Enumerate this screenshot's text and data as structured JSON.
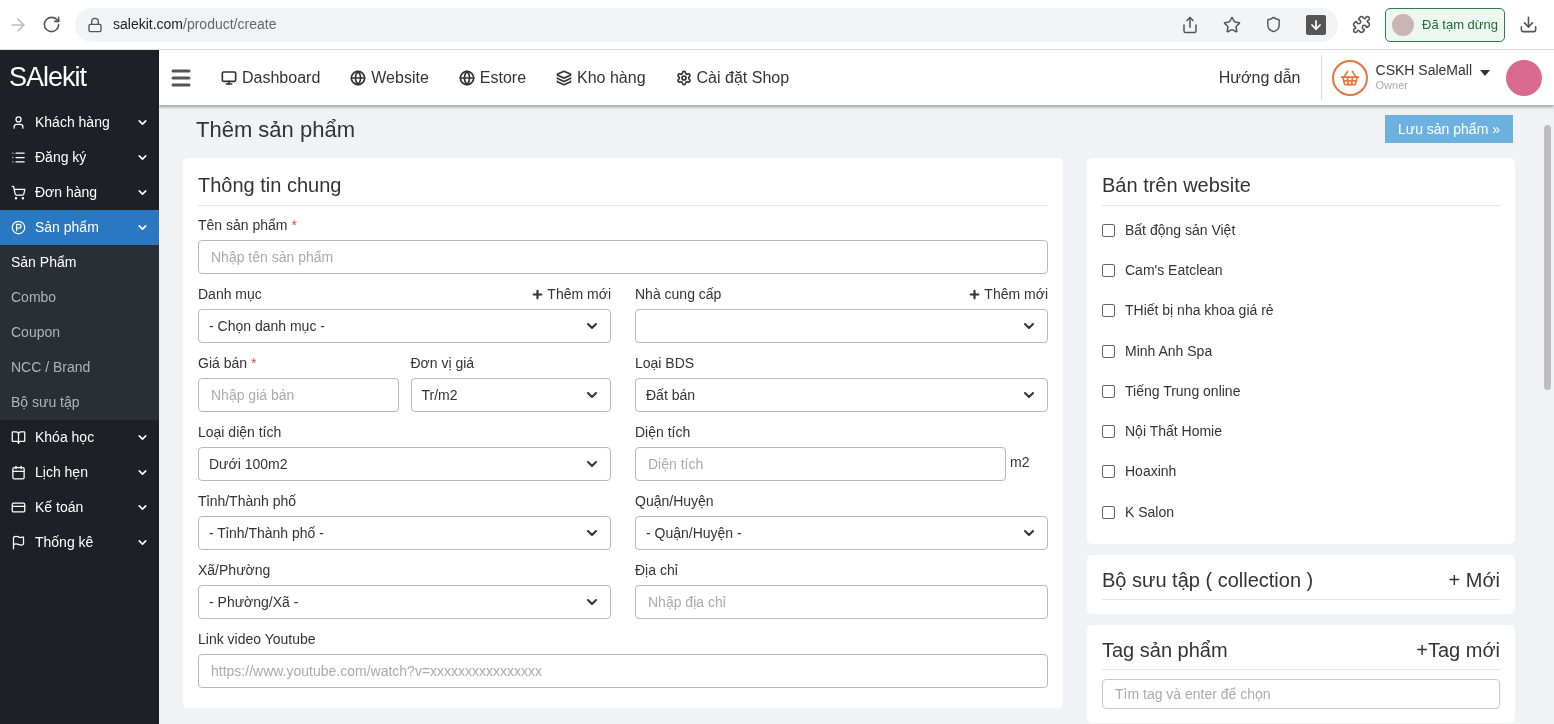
{
  "browser": {
    "url_host": "salekit.com",
    "url_path": "/product/create",
    "profile_label": "Đã tạm dừng"
  },
  "sidebar": {
    "logo": "SAlekit",
    "items": [
      {
        "label": "Khách hàng",
        "selected": false
      },
      {
        "label": "Đăng ký",
        "selected": false
      },
      {
        "label": "Đơn hàng",
        "selected": false
      },
      {
        "label": "Sản phẩm",
        "selected": true,
        "children": [
          {
            "label": "Sản Phẩm",
            "selected": true
          },
          {
            "label": "Combo",
            "selected": false
          },
          {
            "label": "Coupon",
            "selected": false
          },
          {
            "label": "NCC / Brand",
            "selected": false
          },
          {
            "label": "Bộ sưu tập",
            "selected": false
          }
        ]
      },
      {
        "label": "Khóa học",
        "selected": false
      },
      {
        "label": "Lịch hẹn",
        "selected": false
      },
      {
        "label": "Kế toán",
        "selected": false
      },
      {
        "label": "Thống kê",
        "selected": false
      }
    ]
  },
  "topnav": {
    "items": [
      {
        "label": "Dashboard"
      },
      {
        "label": "Website"
      },
      {
        "label": "Estore"
      },
      {
        "label": "Kho hàng"
      },
      {
        "label": "Cài đặt Shop"
      }
    ],
    "help": "Hướng dẫn",
    "account": {
      "name": "CSKH SaleMall",
      "role": "Owner"
    }
  },
  "page": {
    "title": "Thêm sản phẩm",
    "save_button": "Lưu sản phẩm »"
  },
  "general": {
    "title": "Thông tin chung",
    "rows": [
      {
        "columns": [
          [
            {
              "kind": "input",
              "label": "Tên sản phẩm",
              "required_mark": "*",
              "placeholder": "Nhập tên sản phẩm"
            }
          ]
        ]
      },
      {
        "columns": [
          [
            {
              "kind": "select",
              "label": "Danh mục",
              "add_link": "Thêm mới",
              "value": "- Chọn danh mục -"
            }
          ],
          [
            {
              "kind": "select",
              "label": "Nhà cung cấp",
              "add_link": "Thêm mới"
            }
          ]
        ]
      },
      {
        "columns": [
          [
            {
              "kind": "input",
              "label": "Giá bán",
              "required_mark": "*",
              "placeholder": "Nhập giá bán"
            },
            {
              "kind": "select",
              "label": "Đơn vị giá",
              "value": "Tr/m2"
            }
          ],
          [
            {
              "kind": "select",
              "label": "Loại BDS",
              "value": "Đất bán"
            }
          ]
        ]
      },
      {
        "columns": [
          [
            {
              "kind": "select",
              "label": "Loại diện tích",
              "value": "Dưới 100m2"
            }
          ],
          [
            {
              "kind": "input",
              "label": "Diện tích",
              "placeholder": "Diện tích",
              "suffix": "m2"
            }
          ]
        ]
      },
      {
        "columns": [
          [
            {
              "kind": "select",
              "label": "Tỉnh/Thành phố",
              "value": "- Tỉnh/Thành phố -"
            }
          ],
          [
            {
              "kind": "select",
              "label": "Quận/Huyện",
              "value": "- Quận/Huyện -"
            }
          ]
        ]
      },
      {
        "columns": [
          [
            {
              "kind": "select",
              "label": "Xã/Phường",
              "value": "- Phường/Xã -"
            }
          ],
          [
            {
              "kind": "input",
              "label": "Địa chỉ",
              "placeholder": "Nhập địa chỉ"
            }
          ]
        ]
      },
      {
        "columns": [
          [
            {
              "kind": "input",
              "label": "Link video Youtube",
              "placeholder": "https://www.youtube.com/watch?v=xxxxxxxxxxxxxxxx"
            }
          ]
        ]
      }
    ]
  },
  "websites": {
    "title": "Bán trên website",
    "items": [
      {
        "label": "Bất động sản Việt",
        "checked": false
      },
      {
        "label": "Cam's Eatclean",
        "checked": false
      },
      {
        "label": "THiết bị nha khoa giá rẻ",
        "checked": false
      },
      {
        "label": "Minh Anh Spa",
        "checked": false
      },
      {
        "label": "Tiếng Trung online",
        "checked": false
      },
      {
        "label": "Nội Thất Homie",
        "checked": false
      },
      {
        "label": "Hoaxinh",
        "checked": false
      },
      {
        "label": "K Salon",
        "checked": false
      }
    ]
  },
  "collection": {
    "title": "Bộ sưu tập ( collection )",
    "add_link": "+ Mới"
  },
  "tags": {
    "title": "Tag sản phẩm",
    "add_link": "+Tag mới",
    "placeholder": "Tìm tag và enter để chọn"
  }
}
